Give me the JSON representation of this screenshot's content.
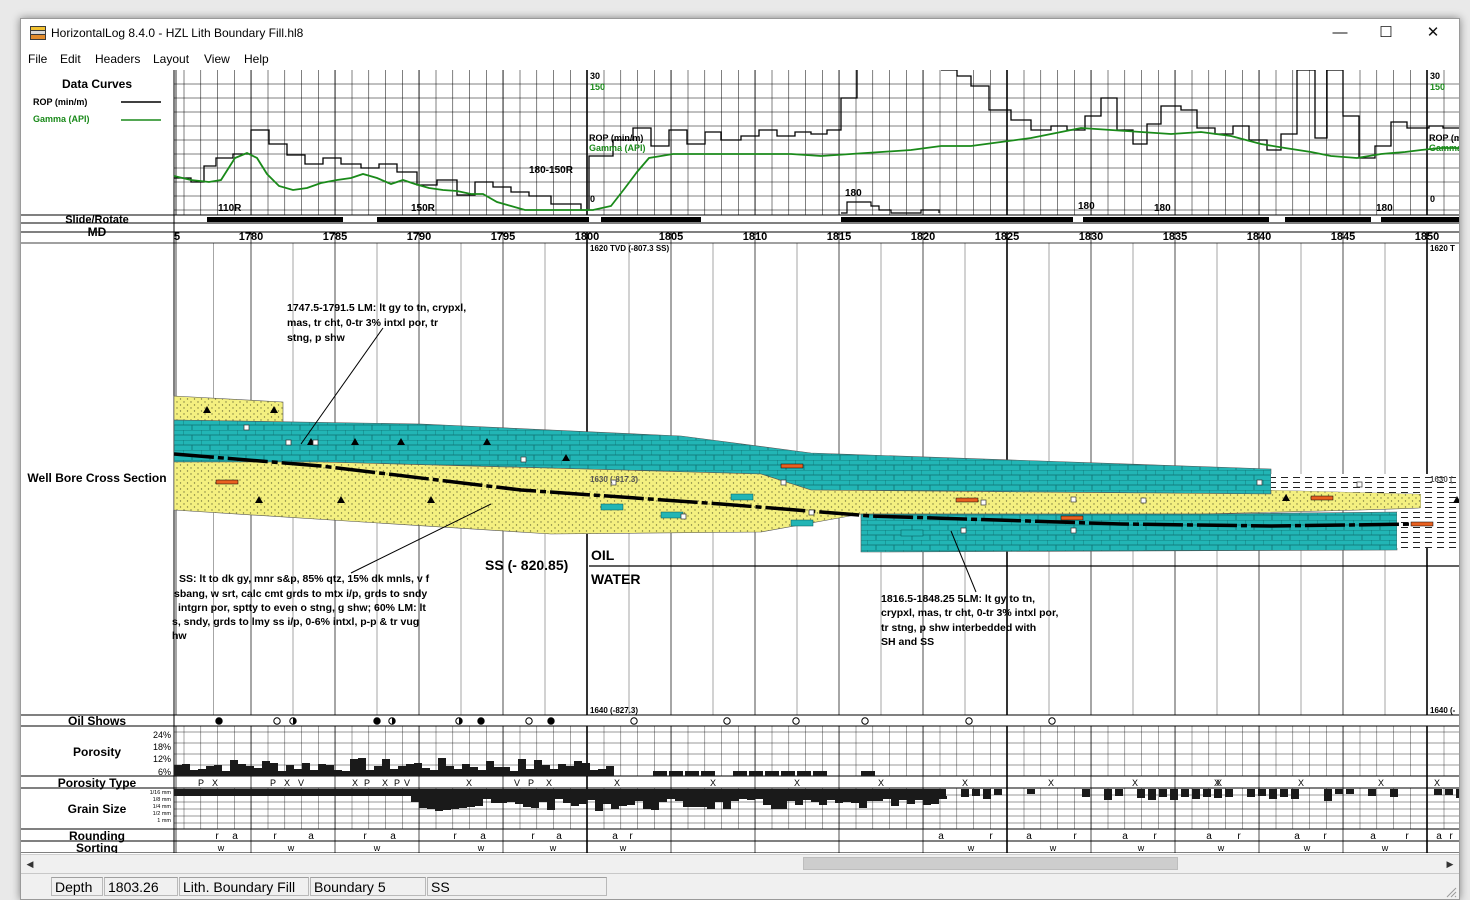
{
  "window": {
    "title": "HorizontalLog 8.4.0 - HZL Lith Boundary Fill.hl8",
    "minimize": "—",
    "maximize": "☐",
    "close": "✕"
  },
  "menu": [
    "File",
    "Edit",
    "Headers",
    "Layout",
    "View",
    "Help"
  ],
  "data_curves": {
    "title": "Data Curves",
    "rop": {
      "label": "ROP (min/m)",
      "color": "#000000"
    },
    "gamma": {
      "label": "Gamma (API)",
      "color": "#1a8a1a"
    }
  },
  "track_labels": {
    "slide_rotate": "Slide/Rotate",
    "md": "MD",
    "cross_section": "Well Bore Cross Section",
    "oil_shows": "Oil Shows",
    "porosity": "Porosity",
    "porosity_type": "Porosity Type",
    "grain_size": "Grain Size",
    "rounding": "Rounding",
    "sorting": "Sorting"
  },
  "md_ticks": [
    "5",
    "1780",
    "1785",
    "1790",
    "1795",
    "1800",
    "1805",
    "1810",
    "1815",
    "1820",
    "1825",
    "1830",
    "1835",
    "1840",
    "1845",
    "1850"
  ],
  "porosity_scale": [
    "24%",
    "18%",
    "12%",
    "6%"
  ],
  "grain_scale": [
    "1/16 mm",
    "1/8 mm",
    "1/4 mm",
    "1/2 mm",
    "1 mm"
  ],
  "scale_top": {
    "rop": "30",
    "gamma": "150"
  },
  "scale_bottom": "0",
  "curve_marks": {
    "r1": "110R",
    "r2": "150R",
    "r3": "180-150R",
    "c1": "180",
    "c2": "180",
    "c3": "180",
    "c4": "180",
    "rop_label": "ROP (min/m)",
    "gamma_label": "Gamma (API)"
  },
  "tvd": {
    "top": "1620 TVD (-807.3 SS)",
    "bottom": "1640 (-827.3)",
    "mid": "1630 (-817.3)",
    "top_right": "1620 T",
    "bottom_right": "1640 (-",
    "mid_right": "1630 ("
  },
  "annotations": {
    "a1": [
      "1747.5-1791.5 LM: lt gy to tn, crypxl,",
      "mas, tr cht, 0-tr 3% intxl por,  tr",
      "stng, p shw"
    ],
    "a2": [
      "SS: lt to dk gy, mnr s&p, 85% qtz, 15% dk mnls, v f",
      "sbang, w srt, calc cmt grds to mtx i/p, grds to sndy",
      "intgrn por, sptty to even o stng, g shw; 60% LM: lt",
      "s, sndy, grds to lmy ss i/p, 0-6% intxl, p-p & tr vug",
      "hw"
    ],
    "a3": [
      "1816.5-1848.25 5LM: lt gy to tn,",
      "crypxl, mas, tr cht, 0-tr 3% intxl por,",
      " tr stng, p shw interbedded with",
      "SH and SS"
    ],
    "ss": "SS  (- 820.85)",
    "oil": "OIL",
    "water": "WATER"
  },
  "porosity_type_marks": [
    "P",
    "X",
    "P",
    "X",
    "V",
    "X",
    "P",
    "X",
    "P",
    "V",
    "X",
    "V",
    "P",
    "X",
    "X",
    "X",
    "X",
    "X",
    "X",
    "X",
    "X",
    "X",
    "X",
    "X",
    "X",
    "X"
  ],
  "rounding_marks": [
    "r",
    "a",
    "r",
    "a",
    "r",
    "a",
    "r",
    "a",
    "r",
    "a",
    "a",
    "r",
    "a",
    "r",
    "a",
    "r",
    "a",
    "r",
    "a",
    "r",
    "a",
    "r",
    "a",
    "r",
    "a",
    "r"
  ],
  "sorting_marks": [
    "w",
    "w",
    "w",
    "w",
    "w",
    "w",
    "w",
    "w",
    "w",
    "w",
    "w",
    "w"
  ],
  "status": {
    "depth_label": "Depth",
    "depth_value": "1803.26",
    "mode": "Lith. Boundary Fill",
    "boundary": "Boundary 5",
    "lith": "SS"
  },
  "colors": {
    "limestone": "#22b5b5",
    "sandstone": "#f4f080",
    "shale": "#ffffff",
    "gamma": "#1a8a1a",
    "grid": "#000000"
  }
}
